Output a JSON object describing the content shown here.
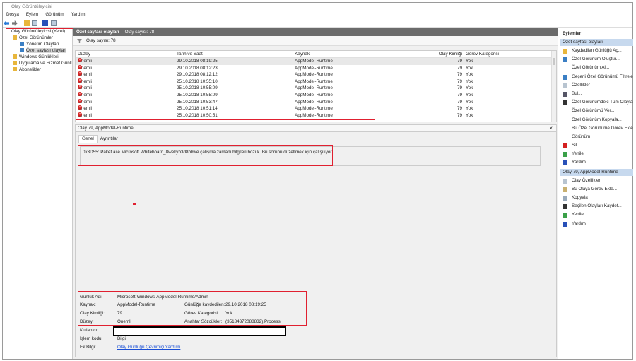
{
  "window": {
    "title": "Olay Görüntüleyicisi"
  },
  "menu": [
    "Dosya",
    "Eylem",
    "Görünüm",
    "Yardım"
  ],
  "tree": {
    "root": "Olay Görüntüleyicisi (Yerel)",
    "items": [
      {
        "label": "Özel Görünümler",
        "level": 1
      },
      {
        "label": "Yönetim Olayları",
        "level": 2
      },
      {
        "label": "Özet sayfası olayları",
        "level": 2,
        "selected": true
      },
      {
        "label": "Windows Günlükleri",
        "level": 1
      },
      {
        "label": "Uygulama ve Hizmet Günlükleri",
        "level": 1
      },
      {
        "label": "Abonelikler",
        "level": 1
      }
    ]
  },
  "main": {
    "header_title": "Özet sayfası olayları",
    "header_count": "Olay sayısı: 78",
    "filter_text": "Olay sayısı: 78",
    "columns": [
      "Düzey",
      "Tarih ve Saat",
      "Kaynak",
      "Olay Kimliği",
      "Görev Kategorisi"
    ],
    "rows": [
      [
        "Önemli",
        "29.10.2018 08:19:25",
        "AppModel-Runtime",
        "79",
        "Yok"
      ],
      [
        "Önemli",
        "29.10.2018 08:12:23",
        "AppModel-Runtime",
        "79",
        "Yok"
      ],
      [
        "Önemli",
        "29.10.2018 08:12:12",
        "AppModel-Runtime",
        "79",
        "Yok"
      ],
      [
        "Önemli",
        "25.10.2018 10:55:10",
        "AppModel-Runtime",
        "79",
        "Yok"
      ],
      [
        "Önemli",
        "25.10.2018 10:55:09",
        "AppModel-Runtime",
        "79",
        "Yok"
      ],
      [
        "Önemli",
        "25.10.2018 10:55:09",
        "AppModel-Runtime",
        "79",
        "Yok"
      ],
      [
        "Önemli",
        "25.10.2018 10:53:47",
        "AppModel-Runtime",
        "79",
        "Yok"
      ],
      [
        "Önemli",
        "25.10.2018 10:51:14",
        "AppModel-Runtime",
        "79",
        "Yok"
      ],
      [
        "Önemli",
        "25.10.2018 10:50:51",
        "AppModel-Runtime",
        "79",
        "Yok"
      ]
    ]
  },
  "detail": {
    "title": "Olay 79, AppModel-Runtime",
    "close": "×",
    "tabs": [
      "Genel",
      "Ayrıntılar"
    ],
    "message": "0x3D55: Paket aile Microsoft.Whiteboard_8wekyb3d8bbwe çalışma zamanı bilgileri bozuk. Bu sorunu düzeltmek için çalışılıyor.",
    "fields": {
      "log_name_label": "Günlük Adı:",
      "log_name": "Microsoft-Windows-AppModel-Runtime/Admin",
      "source_label": "Kaynak:",
      "source": "AppModel-Runtime",
      "logged_label": "Günlüğe kaydedilen:",
      "logged": "29.10.2018 08:19:25",
      "event_id_label": "Olay Kimliği:",
      "event_id": "79",
      "task_label": "Görev Kategorisi:",
      "task": "Yok",
      "level_label": "Düzey:",
      "level": "Önemli",
      "keywords_label": "Anahtar Sözcükler:",
      "keywords": "(35184372088832),Process",
      "user_label": "Kullanıcı:",
      "opcode_label": "İşlem kodu:",
      "opcode": "Bilgi",
      "more_label": "Ek Bilgi:",
      "more_link": "Olay Günlüğü Çevrimiçi Yardımı"
    }
  },
  "actions": {
    "title": "Eylemler",
    "section1": "Özet sayfası olayları",
    "items1": [
      {
        "label": "Kaydedilen Günlüğü Aç...",
        "icon": "folder-open-icon"
      },
      {
        "label": "Özel Görünüm Oluştur...",
        "icon": "filter-icon"
      },
      {
        "label": "Özel Görünüm Al...",
        "icon": ""
      },
      {
        "label": "Geçerli Özel Görünümü Filtrele...",
        "icon": "filter-icon"
      },
      {
        "label": "Özellikler",
        "icon": "properties-icon"
      },
      {
        "label": "Bul...",
        "icon": "binoculars-icon"
      },
      {
        "label": "Özel Görünümdeki Tüm Olayları Farklı Kaydet...",
        "icon": "save-icon"
      },
      {
        "label": "Özel Görünümü Ver...",
        "icon": ""
      },
      {
        "label": "Özel Görünüm Kopyala...",
        "icon": ""
      },
      {
        "label": "Bu Özel Görünüme Görev Ekle...",
        "icon": ""
      },
      {
        "label": "Görünüm",
        "icon": ""
      },
      {
        "label": "Sil",
        "icon": "delete-icon"
      },
      {
        "label": "Yenile",
        "icon": "refresh-icon"
      },
      {
        "label": "Yardım",
        "icon": "help-icon"
      }
    ],
    "section2": "Olay 79, AppModel-Runtime",
    "items2": [
      {
        "label": "Olay Özellikleri",
        "icon": "properties-icon"
      },
      {
        "label": "Bu Olaya Görev Ekle...",
        "icon": "task-icon"
      },
      {
        "label": "Kopyala",
        "icon": "copy-icon"
      },
      {
        "label": "Seçilen Olayları Kaydet...",
        "icon": "save-icon"
      },
      {
        "label": "Yenile",
        "icon": "refresh-icon"
      },
      {
        "label": "Yardım",
        "icon": "help-icon"
      }
    ]
  },
  "colors": {
    "annotation": "#e02030",
    "header": "#6b6b6b",
    "selection": "#c7d9ee",
    "error": "#d42020"
  }
}
